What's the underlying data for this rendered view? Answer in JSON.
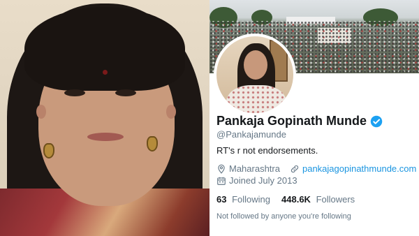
{
  "profile": {
    "display_name": "Pankaja Gopinath Munde",
    "handle": "@Pankajamunde",
    "bio": "RT's r not endorsements.",
    "location": "Maharashtra",
    "website": "pankajagopinathmunde.com",
    "joined": "Joined July 2013",
    "following_count": "63",
    "following_label": "Following",
    "followers_count": "448.6K",
    "followers_label": "Followers",
    "not_followed_text": "Not followed by anyone you're following"
  },
  "icons": {
    "verified": "verified-badge-icon",
    "location": "location-pin-icon",
    "link": "link-icon",
    "calendar": "calendar-icon"
  },
  "colors": {
    "link": "#1b95e0",
    "verified": "#1da1f2",
    "secondary_text": "#657786",
    "primary_text": "#14171a"
  }
}
